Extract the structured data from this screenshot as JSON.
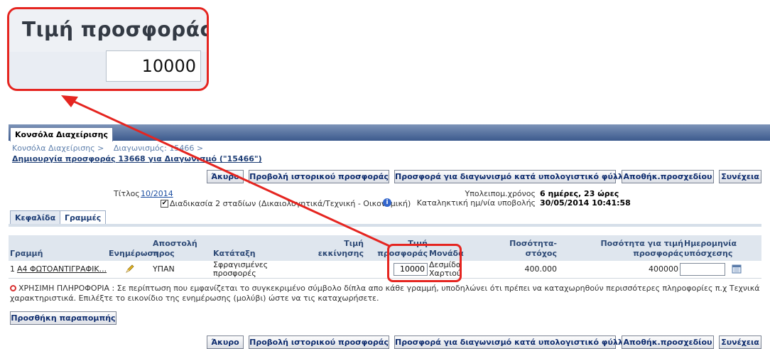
{
  "zoom": {
    "title": "Τιμή προσφοράς",
    "value": "10000"
  },
  "window_tab": "Κονσόλα Διαχείρισης",
  "breadcrumbs": [
    "Κονσόλα Διαχείρισης >",
    "Διαγωνισμός: 15466 >"
  ],
  "page_title": "Δημιουργία προσφοράς 13668 για Διαγωνισμό (\"15466\")",
  "buttons": {
    "cancel": "Άκυρο",
    "history": "Προβολή ιστορικού προσφοράς",
    "spreadsheet": "Προσφορά για διαγωνισμό κατά υπολογιστικό φύλλο",
    "save_draft": "Αποθήκ.προσχεδίου",
    "continue": "Συνέχεια",
    "add_reference": "Προσθήκη παραπομπής"
  },
  "info": {
    "title_label": "Τίτλος",
    "title_value": "10/2014",
    "two_stage_label": "Διαδικασία 2 σταδίων (Δικαιολογητικά/Τεχνική - Οικονομική)",
    "two_stage_checked": true,
    "remaining_label": "Υπολειπομ.χρόνος",
    "remaining_value": "6 ημέρες, 23 ώρες",
    "deadline_label": "Καταληκτική ημ/νία υποβολής",
    "deadline_value": "30/05/2014 10:41:58"
  },
  "tabs": [
    "Κεφαλίδα",
    "Γραμμές"
  ],
  "table": {
    "headers": {
      "line": "Γραμμή",
      "update": "Ενημέρωση",
      "ship_to_1": "Αποστολή",
      "ship_to_2": "προς",
      "category": "Κατάταξη",
      "start_price_1": "Τιμή",
      "start_price_2": "εκκίνησης",
      "bid_price_1": "Τιμή",
      "bid_price_2": "προσφοράς",
      "unit": "Μονάδα",
      "target_qty_1": "Ποσότητα-",
      "target_qty_2": "στόχος",
      "qty_for_price_1": "Ποσότητα για τιμή",
      "qty_for_price_2": "προσφοράς",
      "promise_date_1": "Ημερομηνία",
      "promise_date_2": "υπόσχεσης"
    },
    "row": {
      "line_no": "1",
      "item": "Α4 ΦΩΤΟΑΝΤΙΓΡΑΦΙΚ...",
      "ship_to": "ΥΠΑΝ",
      "category_1": "Σφραγισμένες",
      "category_2": "προσφορές",
      "bid_price": "10000",
      "unit_1": "Δεσμίδα",
      "unit_2": "Χαρτιού",
      "target_qty": "400.000",
      "qty_for_price": "400000",
      "promise_date": ""
    }
  },
  "note": "ΧΡΗΣΙΜΗ ΠΛΗΡΟΦΟΡΙΑ : Σε περίπτωση που εμφανίζεται το συγκεκριμένο σύμβολο δίπλα απο κάθε γραμμή, υποδηλώνει ότι πρέπει να καταχωρηθούν περισσότερες πληροφορίες π.χ Τεχνικά χαρακτηριστικά. Επιλέξτε το εικονίδιο της ενημέρωσης (μολύβι) ώστε να τις καταχωρήσετε.",
  "colors": {
    "highlight": "#e52520",
    "link": "#1e50a2",
    "header_bar": "#3c5a8d"
  }
}
